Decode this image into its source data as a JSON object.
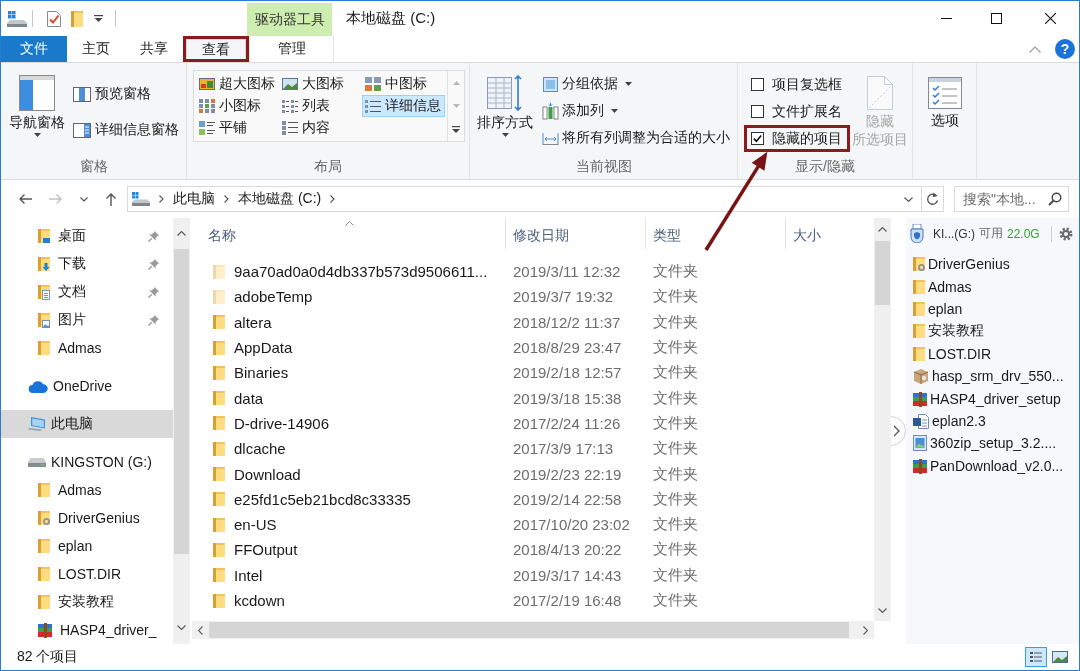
{
  "title_bar": {
    "title": "本地磁盘 (C:)",
    "context_tab_group": "驱动器工具"
  },
  "ribbon_tabs": [
    {
      "label": "文件",
      "kind": "file",
      "selected": false,
      "highlighted": false
    },
    {
      "label": "主页",
      "kind": "standard",
      "selected": false,
      "highlighted": false
    },
    {
      "label": "共享",
      "kind": "standard",
      "selected": false,
      "highlighted": false
    },
    {
      "label": "查看",
      "kind": "standard",
      "selected": true,
      "highlighted": true
    },
    {
      "label": "管理",
      "kind": "contextual",
      "selected": false,
      "highlighted": false
    }
  ],
  "help_button": "?",
  "ribbon": {
    "panes_group": {
      "label": "窗格",
      "navigation_pane_button": "导航窗格",
      "pane_buttons": [
        {
          "label": "预览窗格",
          "kind": "preview"
        },
        {
          "label": "详细信息窗格",
          "kind": "details"
        }
      ]
    },
    "layout_group": {
      "label": "布局",
      "options": [
        {
          "label": "超大图标",
          "kind": "extra-large-icons",
          "selected": false
        },
        {
          "label": "大图标",
          "kind": "large-icons",
          "selected": false
        },
        {
          "label": "中图标",
          "kind": "medium-icons",
          "selected": false
        },
        {
          "label": "小图标",
          "kind": "small-icons",
          "selected": false
        },
        {
          "label": "列表",
          "kind": "list",
          "selected": false
        },
        {
          "label": "详细信息",
          "kind": "details",
          "selected": true
        },
        {
          "label": "平铺",
          "kind": "tiles",
          "selected": false
        },
        {
          "label": "内容",
          "kind": "content",
          "selected": false
        }
      ]
    },
    "current_view_group": {
      "label": "当前视图",
      "sort_button": "排序方式",
      "commands": [
        {
          "label": "分组依据",
          "kind": "group-by",
          "dropdown": true
        },
        {
          "label": "添加列",
          "kind": "add-columns",
          "dropdown": true
        },
        {
          "label": "将所有列调整为合适的大小",
          "kind": "size-columns",
          "dropdown": false
        }
      ]
    },
    "show_hide_group": {
      "label": "显示/隐藏",
      "checkboxes": [
        {
          "label": "项目复选框",
          "checked": false,
          "highlighted": false,
          "arrow": false
        },
        {
          "label": "文件扩展名",
          "checked": false,
          "highlighted": false,
          "arrow": false
        },
        {
          "label": "隐藏的项目",
          "checked": true,
          "highlighted": true,
          "arrow": true
        }
      ],
      "hide_selected_button": {
        "lines": [
          "隐藏",
          "所选项目"
        ],
        "disabled": true
      }
    },
    "options_button": "选项"
  },
  "address_bar": {
    "nav_buttons": [
      {
        "kind": "back",
        "disabled": false
      },
      {
        "kind": "forward",
        "disabled": true
      },
      {
        "kind": "recent",
        "disabled": false
      },
      {
        "kind": "up",
        "disabled": false
      }
    ],
    "path": [
      "此电脑",
      "本地磁盘 (C:)"
    ]
  },
  "search": {
    "placeholder": "搜索\"本地..."
  },
  "nav_pane": {
    "quick_access_items": [
      {
        "label": "桌面",
        "kind": "desktop",
        "pinned": true,
        "selected": false
      },
      {
        "label": "下载",
        "kind": "downloads",
        "pinned": true,
        "selected": false
      },
      {
        "label": "文档",
        "kind": "documents",
        "pinned": true,
        "selected": false
      },
      {
        "label": "图片",
        "kind": "pictures",
        "pinned": true,
        "selected": false
      },
      {
        "label": "Admas",
        "kind": "folder",
        "pinned": false,
        "selected": false
      }
    ],
    "items": [
      {
        "label": "OneDrive",
        "kind": "cloud",
        "selected": false
      },
      {
        "label": "此电脑",
        "kind": "computer",
        "selected": true
      },
      {
        "label": "KINGSTON (G:)",
        "kind": "drive",
        "selected": false,
        "children": [
          {
            "label": "Admas",
            "kind": "folder",
            "selected": false
          },
          {
            "label": "DriverGenius",
            "kind": "app-folder",
            "selected": false
          },
          {
            "label": "eplan",
            "kind": "folder",
            "selected": false
          },
          {
            "label": "LOST.DIR",
            "kind": "folder",
            "selected": false
          },
          {
            "label": "安装教程",
            "kind": "folder",
            "selected": false
          },
          {
            "label": "HASP4_driver_",
            "kind": "archive",
            "selected": false
          }
        ]
      }
    ]
  },
  "file_list": {
    "columns": [
      {
        "label": "名称",
        "sorted": true
      },
      {
        "label": "修改日期",
        "sorted": false
      },
      {
        "label": "类型",
        "sorted": false
      },
      {
        "label": "大小",
        "sorted": false
      }
    ],
    "rows": [
      {
        "name": "9aa70ad0a0d4db337b573d9506611...",
        "date": "2019/3/11 12:32",
        "type": "文件夹",
        "hidden": true,
        "selected": false
      },
      {
        "name": "adobeTemp",
        "date": "2019/3/7 19:32",
        "type": "文件夹",
        "hidden": true,
        "selected": false
      },
      {
        "name": "altera",
        "date": "2018/12/2 11:37",
        "type": "文件夹",
        "hidden": false,
        "selected": false
      },
      {
        "name": "AppData",
        "date": "2018/8/29 23:47",
        "type": "文件夹",
        "hidden": false,
        "selected": false
      },
      {
        "name": "Binaries",
        "date": "2019/2/18 12:57",
        "type": "文件夹",
        "hidden": false,
        "selected": false
      },
      {
        "name": "data",
        "date": "2019/3/18 15:38",
        "type": "文件夹",
        "hidden": false,
        "selected": false
      },
      {
        "name": "D-drive-14906",
        "date": "2017/2/24 11:26",
        "type": "文件夹",
        "hidden": false,
        "selected": false
      },
      {
        "name": "dlcache",
        "date": "2017/3/9 17:13",
        "type": "文件夹",
        "hidden": false,
        "selected": false
      },
      {
        "name": "Download",
        "date": "2019/2/23 22:19",
        "type": "文件夹",
        "hidden": false,
        "selected": false
      },
      {
        "name": "e25fd1c5eb21bcd8c33335",
        "date": "2019/2/14 22:58",
        "type": "文件夹",
        "hidden": false,
        "selected": false
      },
      {
        "name": "en-US",
        "date": "2017/10/20 23:02",
        "type": "文件夹",
        "hidden": false,
        "selected": false
      },
      {
        "name": "FFOutput",
        "date": "2018/4/13 20:22",
        "type": "文件夹",
        "hidden": false,
        "selected": false
      },
      {
        "name": "Intel",
        "date": "2019/3/17 14:43",
        "type": "文件夹",
        "hidden": false,
        "selected": false
      },
      {
        "name": "kcdown",
        "date": "2017/2/19 16:48",
        "type": "文件夹",
        "hidden": false,
        "selected": false
      }
    ]
  },
  "side_panel": {
    "drive": "KI...(G:)",
    "free_label": "可用",
    "free_space": "22.0G",
    "items": [
      {
        "label": "DriverGenius",
        "kind": "app-folder"
      },
      {
        "label": "Admas",
        "kind": "folder"
      },
      {
        "label": "eplan",
        "kind": "folder"
      },
      {
        "label": "安装教程",
        "kind": "folder"
      },
      {
        "label": "LOST.DIR",
        "kind": "folder"
      },
      {
        "label": "hasp_srm_drv_550...",
        "kind": "package"
      },
      {
        "label": "HASP4_driver_setup",
        "kind": "archive"
      },
      {
        "label": "eplan2.3",
        "kind": "document"
      },
      {
        "label": "360zip_setup_3.2....",
        "kind": "program"
      },
      {
        "label": "PanDownload_v2.0...",
        "kind": "archive"
      }
    ]
  },
  "status_bar": {
    "item_count": "82 个项目",
    "view_buttons": [
      {
        "kind": "details",
        "selected": true
      },
      {
        "kind": "large-icons",
        "selected": false
      }
    ]
  }
}
